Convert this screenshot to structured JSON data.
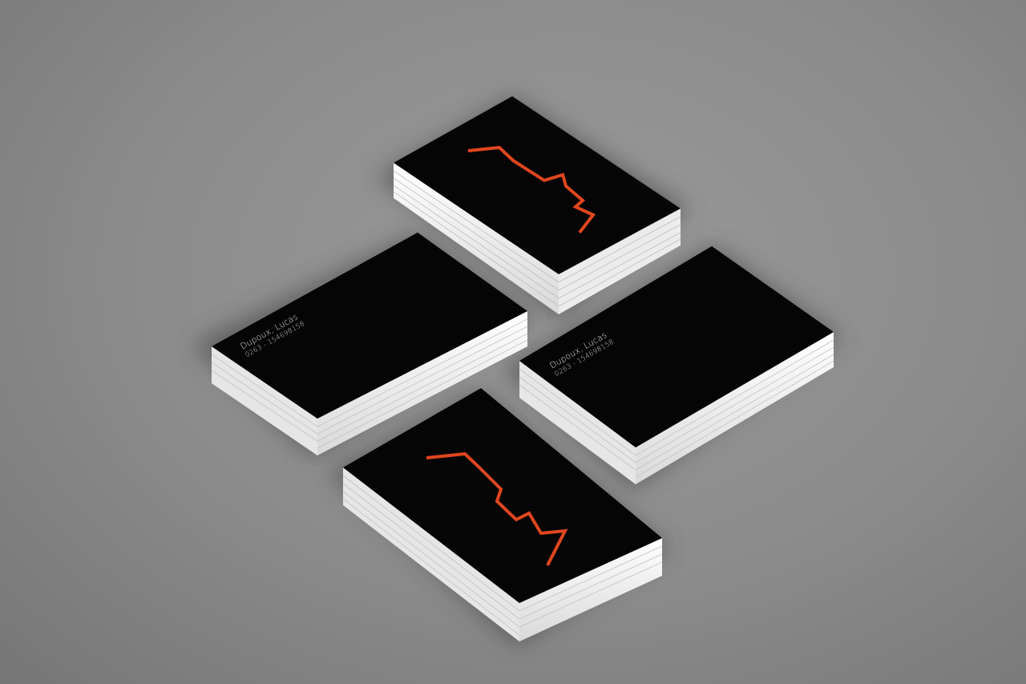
{
  "scene": {
    "background_color": "#8b8b8b",
    "card_face_color": "#050505",
    "card_edge_color": "#f2f2f2",
    "logo_color": "#e0461f"
  },
  "card_back": {
    "name": "Dupoux, Lucas",
    "phone": "0263 - 154698158"
  }
}
